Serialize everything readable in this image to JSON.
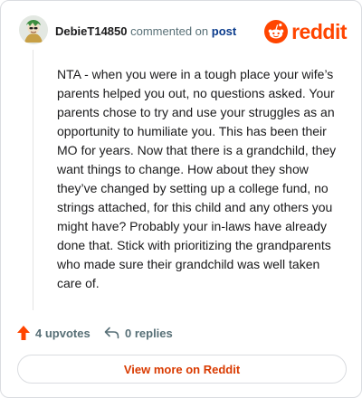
{
  "header": {
    "username": "DebieT14850",
    "action_text": "commented on",
    "post_link": "post",
    "brand": "reddit"
  },
  "comment": {
    "text": "NTA - when you were in a tough place your wife’s parents helped you out, no questions asked. Your parents chose to try and use your struggles as an opportunity to humiliate you. This has been their MO for years. Now that there is a grandchild, they want things to change. How about they show they’ve changed by setting up a college fund, no strings attached, for this child and any others you might have? Probably your in-laws have already done that. Stick with prioritizing the grandparents who made sure their grandchild was well taken care of."
  },
  "stats": {
    "upvotes": "4 upvotes",
    "replies": "0 replies"
  },
  "footer": {
    "view_more": "View more on Reddit"
  },
  "colors": {
    "brand": "#ff4500",
    "link": "#0a3b8c",
    "button_text": "#d93a00"
  },
  "icons": {
    "avatar": "user-avatar",
    "logo": "reddit-logo-icon",
    "upvote": "upvote-arrow-icon",
    "reply": "reply-arrow-icon"
  }
}
